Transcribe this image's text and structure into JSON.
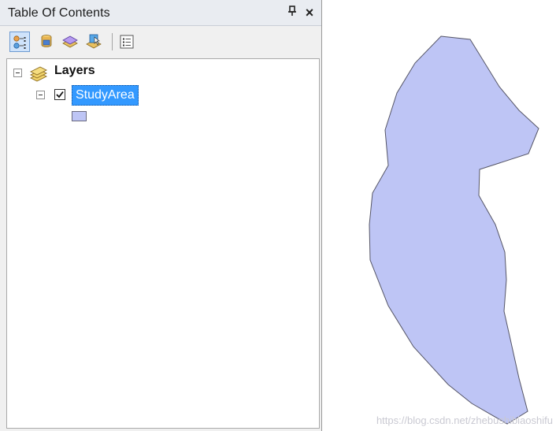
{
  "toc": {
    "title": "Table Of Contents",
    "pin_icon": "p",
    "close_icon": "×",
    "toolbar": [
      {
        "name": "list-by-drawing-order",
        "icon": "list-by-drawing-order-icon",
        "selected": true
      },
      {
        "name": "list-by-source",
        "icon": "list-by-source-icon",
        "selected": false
      },
      {
        "name": "list-by-visibility",
        "icon": "list-by-visibility-icon",
        "selected": false
      },
      {
        "name": "list-by-selection",
        "icon": "list-by-selection-icon",
        "selected": false
      },
      {
        "name": "options",
        "icon": "options-icon",
        "selected": false
      }
    ],
    "tree": {
      "root_label": "Layers",
      "layer": {
        "name": "StudyArea",
        "checked": true,
        "symbol_color": "#bec5f5"
      }
    }
  },
  "map": {
    "feature_fill": "#bec5f5",
    "feature_stroke": "#555566"
  },
  "watermark": "https://blog.csdn.net/zhebushibiaoshifu",
  "colors": {
    "selection": "#3399ff",
    "panel": "#f0f0f0"
  }
}
